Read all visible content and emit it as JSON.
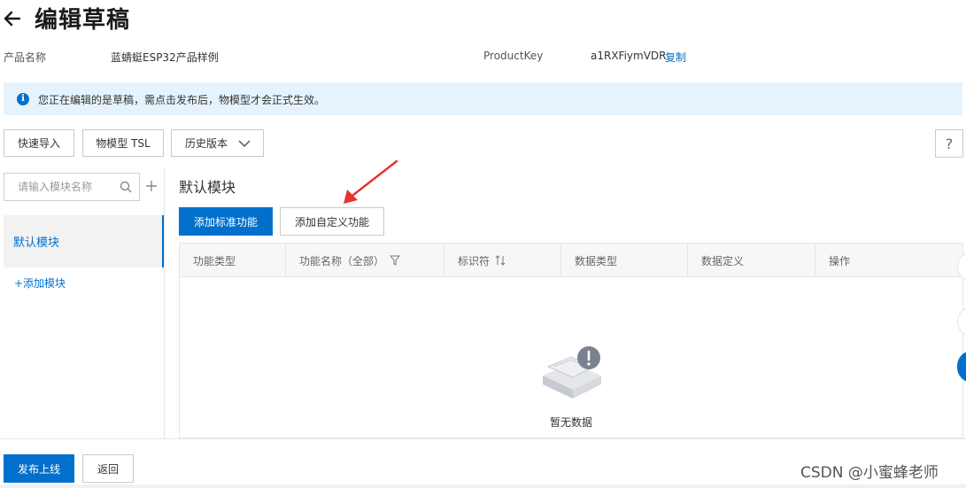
{
  "header": {
    "title": "编辑草稿"
  },
  "product": {
    "name_label": "产品名称",
    "name_value": "蓝蜻蜓ESP32产品样例",
    "key_label": "ProductKey",
    "key_value": "a1RXFiymVDR",
    "copy_label": "复制"
  },
  "notice": {
    "text": "您正在编辑的是草稿，需点击发布后，物模型才会正式生效。"
  },
  "toolbar": {
    "quick_import": "快速导入",
    "tsl": "物模型 TSL",
    "history": "历史版本",
    "help": "?"
  },
  "sidebar": {
    "search_placeholder": "请输入模块名称",
    "items": [
      {
        "label": "默认模块"
      }
    ],
    "add_module": "+添加模块"
  },
  "main": {
    "section_title": "默认模块",
    "add_standard": "添加标准功能",
    "add_custom": "添加自定义功能",
    "columns": [
      "功能类型",
      "功能名称（全部）",
      "标识符",
      "数据类型",
      "数据定义",
      "操作"
    ],
    "empty_text": "暂无数据"
  },
  "footer": {
    "publish": "发布上线",
    "back": "返回"
  },
  "watermark": "CSDN @小蜜蜂老师",
  "colors": {
    "primary": "#0070cc",
    "notice_bg": "#e6f3fc",
    "arrow": "#e8322f"
  }
}
